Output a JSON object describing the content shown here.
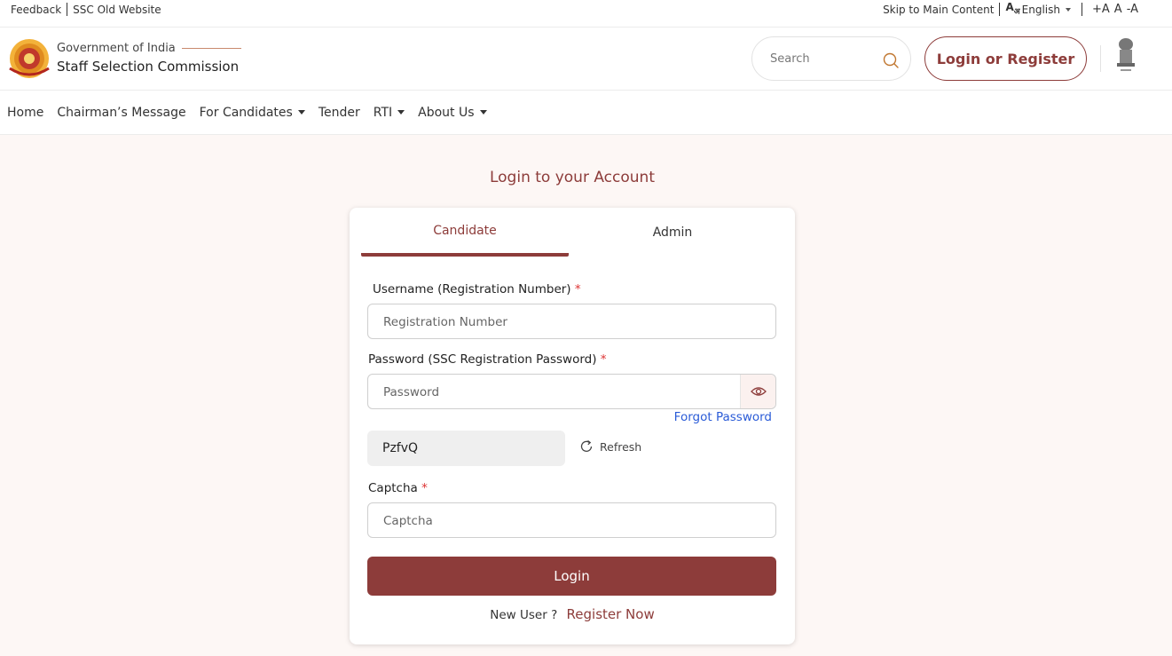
{
  "topbar": {
    "feedback": "Feedback",
    "old_site": "SSC Old Website",
    "skip": "Skip to Main Content",
    "language": "English",
    "font_increase": "+A",
    "font_normal": "A",
    "font_decrease": "-A"
  },
  "header": {
    "gov_line": "Government of India",
    "org_name": "Staff Selection Commission",
    "search_placeholder": "Search",
    "login_register": "Login or Register"
  },
  "nav": {
    "items": [
      {
        "label": "Home"
      },
      {
        "label": "Chairman’s Message"
      },
      {
        "label": "For Candidates"
      },
      {
        "label": "Tender"
      },
      {
        "label": "RTI"
      },
      {
        "label": "About Us"
      }
    ]
  },
  "main": {
    "title": "Login to your Account",
    "tabs": [
      {
        "label": "Candidate",
        "active": true
      },
      {
        "label": "Admin",
        "active": false
      }
    ],
    "username_label": "Username (Registration Number)",
    "username_placeholder": "Registration Number",
    "password_label": "Password (SSC Registration Password)",
    "password_placeholder": "Password",
    "forgot_password": "Forgot Password",
    "captcha_code": "PzfvQ",
    "refresh_label": "Refresh",
    "captcha_label": "Captcha",
    "captcha_placeholder": "Captcha",
    "login_button": "Login",
    "new_user_text": "New User ?",
    "register_link": "Register Now",
    "required_mark": "*"
  },
  "colors": {
    "brand": "#8d3c3a",
    "link": "#2a5bd7",
    "page_bg": "#fdf7f5"
  }
}
